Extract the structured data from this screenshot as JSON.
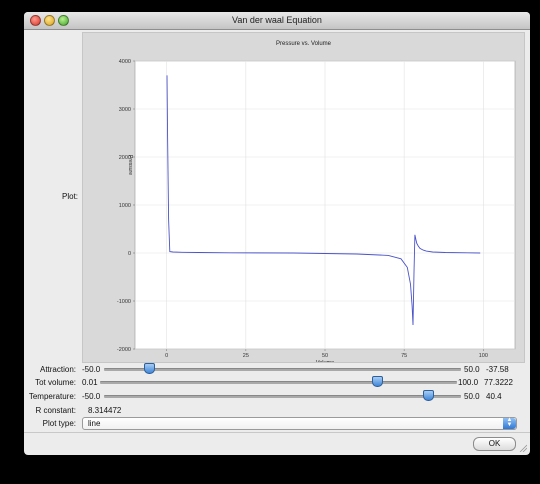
{
  "window": {
    "title": "Van der waal Equation"
  },
  "plot": {
    "label": "Plot:"
  },
  "chart_data": {
    "type": "line",
    "title": "Pressure vs. Volume",
    "xlabel": "Volume",
    "ylabel": "Pressure",
    "xlim": [
      -10,
      110
    ],
    "ylim": [
      -2000,
      4000
    ],
    "xticks": [
      0,
      25,
      50,
      75,
      100
    ],
    "yticks": [
      -2000,
      -1000,
      0,
      1000,
      2000,
      3000,
      4000
    ],
    "grid": true,
    "series": [
      {
        "color": "#4a53c9",
        "x": [
          0.1,
          0.3,
          0.6,
          1,
          2,
          5,
          10,
          20,
          40,
          60,
          70,
          74,
          76,
          77,
          77.5,
          77.8,
          78.1,
          78.4,
          78.7,
          79,
          79.5,
          80,
          81,
          82,
          84,
          88,
          95,
          99
        ],
        "y": [
          3700,
          2400,
          700,
          30,
          20,
          15,
          10,
          5,
          0,
          -20,
          -50,
          -120,
          -300,
          -650,
          -1100,
          -1500,
          -400,
          380,
          280,
          200,
          140,
          95,
          60,
          40,
          20,
          10,
          5,
          0
        ]
      }
    ]
  },
  "controls": {
    "attraction": {
      "label": "Attraction:",
      "min": "-50.0",
      "max": "50.0",
      "value": "-37.58",
      "fraction": 0.124
    },
    "tot_volume": {
      "label": "Tot volume:",
      "min": "0.01",
      "max": "100.0",
      "value": "77.3222",
      "fraction": 0.773
    },
    "temperature": {
      "label": "Temperature:",
      "min": "-50.0",
      "max": "50.0",
      "value": "40.4",
      "fraction": 0.904
    },
    "r_constant": {
      "label": "R constant:",
      "value": "8.314472"
    },
    "plot_type": {
      "label": "Plot type:",
      "value": "line"
    }
  },
  "buttons": {
    "ok": "OK"
  }
}
